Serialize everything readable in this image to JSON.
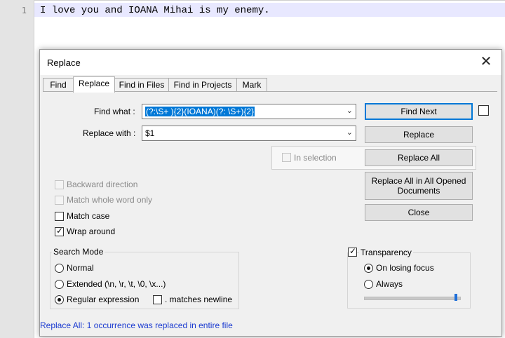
{
  "editor": {
    "line_number": "1",
    "line_text": "I love you and IOANA Mihai is my enemy."
  },
  "dialog": {
    "title": "Replace",
    "tabs": [
      {
        "label": "Find"
      },
      {
        "label": "Replace"
      },
      {
        "label": "Find in Files"
      },
      {
        "label": "Find in Projects"
      },
      {
        "label": "Mark"
      }
    ],
    "find_label": "Find what :",
    "find_value": "(?:\\S+ ){2}(IOANA)(?: \\S+){2}",
    "replace_label": "Replace with :",
    "replace_value": "$1",
    "in_selection": "In selection",
    "buttons": {
      "find_next": "Find Next",
      "replace": "Replace",
      "replace_all": "Replace All",
      "replace_all_opened": "Replace All in All Opened Documents",
      "close": "Close"
    },
    "options": {
      "backward": "Backward direction",
      "whole_word": "Match whole word only",
      "match_case": "Match case",
      "wrap_around": "Wrap around"
    },
    "search_mode": {
      "title": "Search Mode",
      "normal": "Normal",
      "extended": "Extended (\\n, \\r, \\t, \\0, \\x...)",
      "regex": "Regular expression",
      "matches_newline": ". matches newline",
      "selected": "regex"
    },
    "transparency": {
      "title": "Transparency",
      "on_losing_focus": "On losing focus",
      "always": "Always",
      "selected": "on_losing_focus",
      "checked": true,
      "level": 0.98
    },
    "status": "Replace All: 1 occurrence was replaced in entire file"
  },
  "colors": {
    "status_text": "#1a3ad0",
    "selection": "#0078d7",
    "current_line": "#e8e8ff"
  }
}
